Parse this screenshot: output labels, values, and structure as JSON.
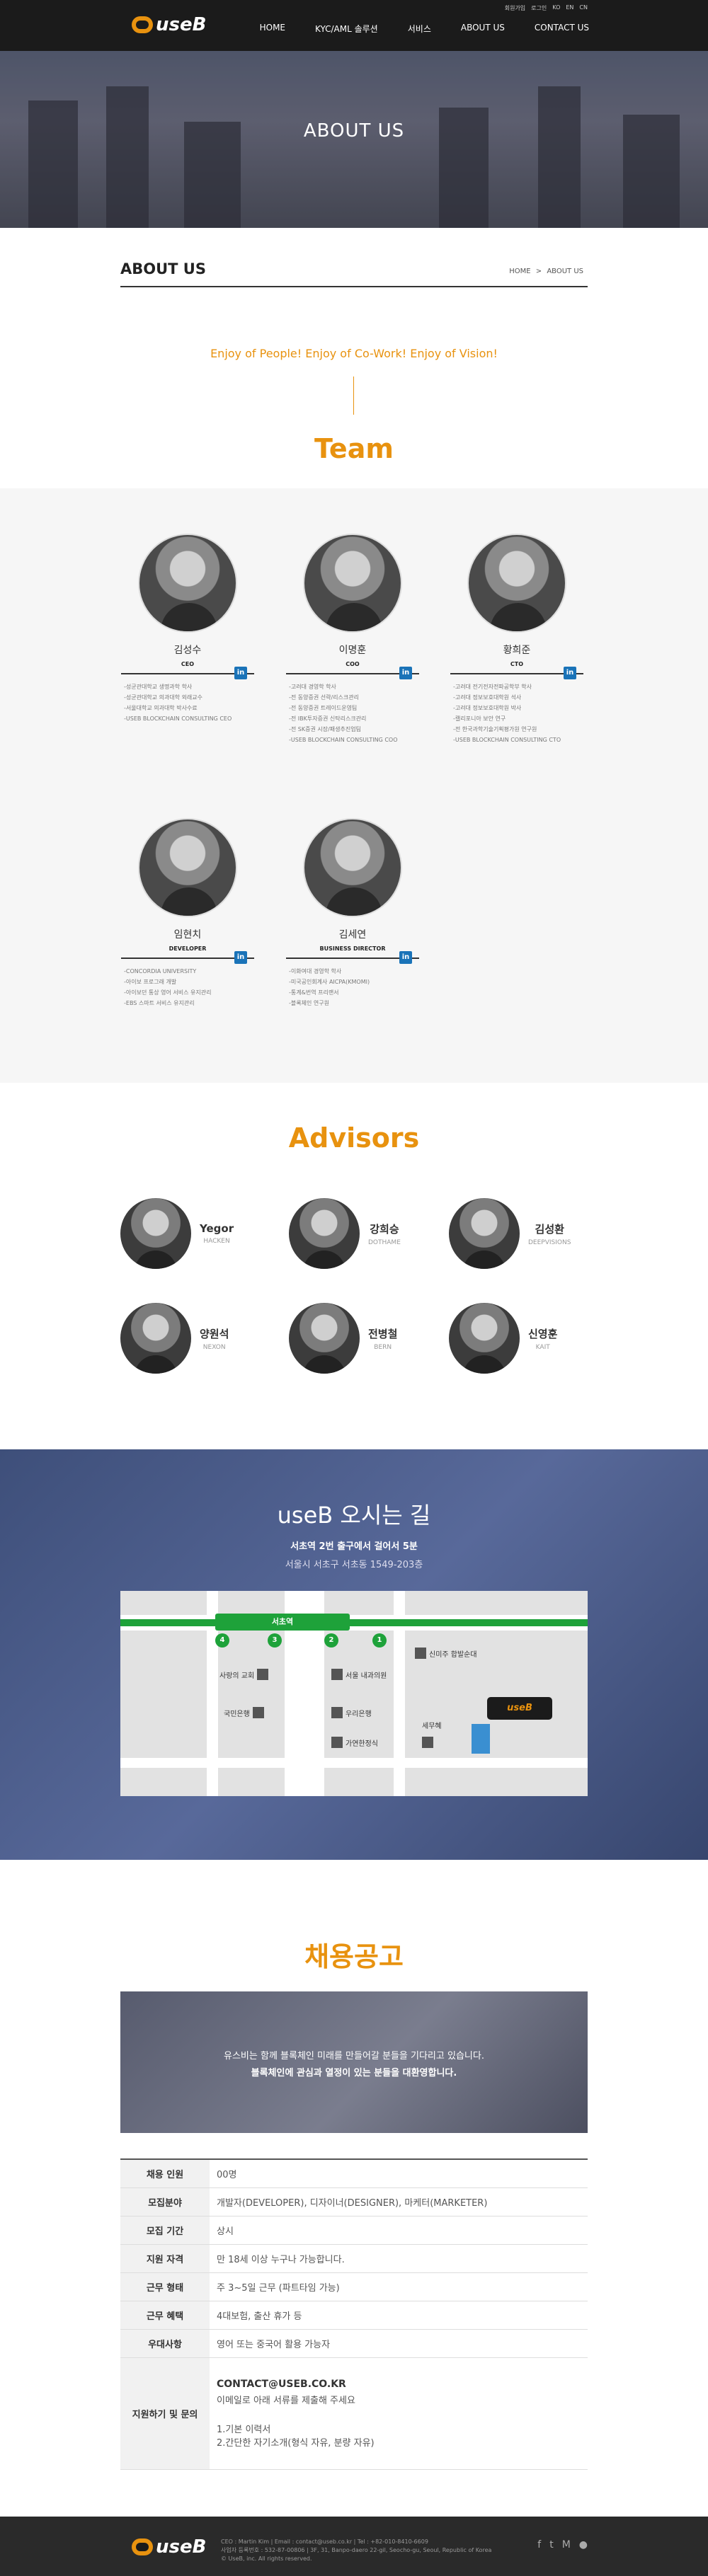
{
  "header": {
    "logo_text": "useB",
    "util": [
      "회원가입",
      "로그인",
      "KO",
      "EN",
      "CN"
    ],
    "nav": [
      "HOME",
      "KYC/AML 솔루션",
      "서비스",
      "ABOUT US",
      "CONTACT US"
    ]
  },
  "hero": {
    "title": "ABOUT US"
  },
  "page": {
    "title": "ABOUT US",
    "breadcrumb_home": "HOME",
    "breadcrumb_sep": ">",
    "breadcrumb_current": "ABOUT US"
  },
  "slogan": "Enjoy of People! Enjoy of Co-Work! Enjoy of Vision!",
  "team": {
    "title": "Team",
    "members": [
      {
        "name": "김성수",
        "role": "CEO",
        "history": [
          "-성균관대학교 생명과학 학사",
          "-성균관대학교 의과대학 외래교수",
          "-서울대학교 의과대학 박사수료",
          "-USEB BLOCKCHAIN CONSULTING CEO"
        ]
      },
      {
        "name": "이명훈",
        "role": "COO",
        "history": [
          "-고려대 경영학 학사",
          "-전 동양증권 선략/리스크관리",
          "-전 동양증권 트레이드운영팀",
          "-전 IBK투자증권 신탁리스크관리",
          "-전 SK증권 시장/패생추진업팀",
          "-USEB BLOCKCHAIN CONSULTING COO"
        ]
      },
      {
        "name": "황희준",
        "role": "CTO",
        "history": [
          "-고려대 전기전자전파공학부 학사",
          "-고려대 정보보호대학원 석사",
          "-고려대 정보보호대학원 박사",
          "-캘리포니아 보안 연구",
          "-전 한국과학기술기획평가원 연구원",
          "-USEB BLOCKCHAIN CONSULTING CTO"
        ]
      },
      {
        "name": "임현치",
        "role": "DEVELOPER",
        "history": [
          "-CONCORDIA UNIVERSITY",
          "-아이보 프로그래 개발",
          "-아이보던 통상 영어 서비스 유지관리",
          "-EBS 스마트 서비스 유지관리"
        ]
      },
      {
        "name": "김세연",
        "role": "BUSINESS DIRECTOR",
        "history": [
          "-이화여대 경영학 학사",
          "-미국공인회계사 AICPA(KMOMI)",
          "-통계&번역 프리랜서",
          "-블록체인 연구원"
        ]
      }
    ]
  },
  "advisors": {
    "title": "Advisors",
    "list": [
      {
        "name": "Yegor",
        "company": "HACKEN"
      },
      {
        "name": "강희승",
        "company": "DOTHAME"
      },
      {
        "name": "김성환",
        "company": "DEEPVISIONS"
      },
      {
        "name": "양원석",
        "company": "NEXON"
      },
      {
        "name": "전병철",
        "company": "BERN"
      },
      {
        "name": "신영훈",
        "company": "KAIT"
      }
    ]
  },
  "location": {
    "title": "useB 오시는 길",
    "sub1": "서초역 2번 출구에서 걸어서 5분",
    "sub2": "서울시 서초구 서초동 1549-203층",
    "station": "서초역",
    "exits": [
      "4",
      "3",
      "2",
      "1"
    ],
    "buildings": [
      "사랑의 교회",
      "국민은행",
      "서울 내과의원",
      "우리은행",
      "가연한정식",
      "신미주 합발순대",
      "세무혜"
    ],
    "pin_label": "useB"
  },
  "recruit": {
    "title": "채용공고",
    "banner_line1": "유스비는 함께 블록체인 미래를 만들어갈 분들을 기다리고 있습니다.",
    "banner_line2": "블록체인에 관심과 열정이 있는 분들을 대환영합니다.",
    "rows": [
      {
        "label": "채용 인원",
        "value": "00명"
      },
      {
        "label": "모집분야",
        "value": "개발자(DEVELOPER), 디자이너(DESIGNER), 마케터(MARKETER)"
      },
      {
        "label": "모집 기간",
        "value": "상시"
      },
      {
        "label": "지원 자격",
        "value": "만 18세 이상 누구나 가능합니다."
      },
      {
        "label": "근무 형태",
        "value": "주 3~5일 근무 (파트타임 가능)"
      },
      {
        "label": "근무 혜택",
        "value": "4대보험, 출산 휴가 등"
      },
      {
        "label": "우대사항",
        "value": "영어 또는 중국어 활용 가능자"
      }
    ],
    "contact_label": "지원하기 및 문의",
    "contact_email": "CONTACT@USEB.CO.KR",
    "contact_desc": "이메일로 아래 서류를 제출해 주세요",
    "contact_docs": [
      "1.기본 이력서",
      "2.간단한 자기소개(형식 자유, 분량 자유)"
    ]
  },
  "footer": {
    "logo_text": "useB",
    "line1": "CEO : Martin Kim  |  Email : contact@useb.co.kr  |  Tel : +82-010-8410-6609",
    "line2": "사업자 등록번호 : 532-87-00806  |  3F, 31, Banpo-daero 22-gil, Seocho-gu, Seoul, Republic of Korea",
    "line3": "© UseB, inc. All rights reserved.",
    "social": [
      "f",
      "t",
      "M",
      "●"
    ]
  }
}
